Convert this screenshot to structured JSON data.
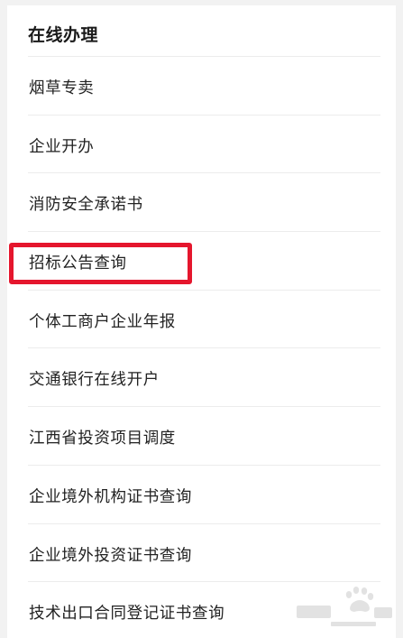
{
  "section": {
    "title": "在线办理"
  },
  "items": [
    {
      "label": "烟草专卖"
    },
    {
      "label": "企业开办"
    },
    {
      "label": "消防安全承诺书"
    },
    {
      "label": "招标公告查询"
    },
    {
      "label": "个体工商户企业年报"
    },
    {
      "label": "交通银行在线开户"
    },
    {
      "label": "江西省投资项目调度"
    },
    {
      "label": "企业境外机构证书查询"
    },
    {
      "label": "企业境外投资证书查询"
    },
    {
      "label": "技术出口合同登记证书查询"
    }
  ],
  "annotation": {
    "highlight_color": "#e5162d"
  }
}
